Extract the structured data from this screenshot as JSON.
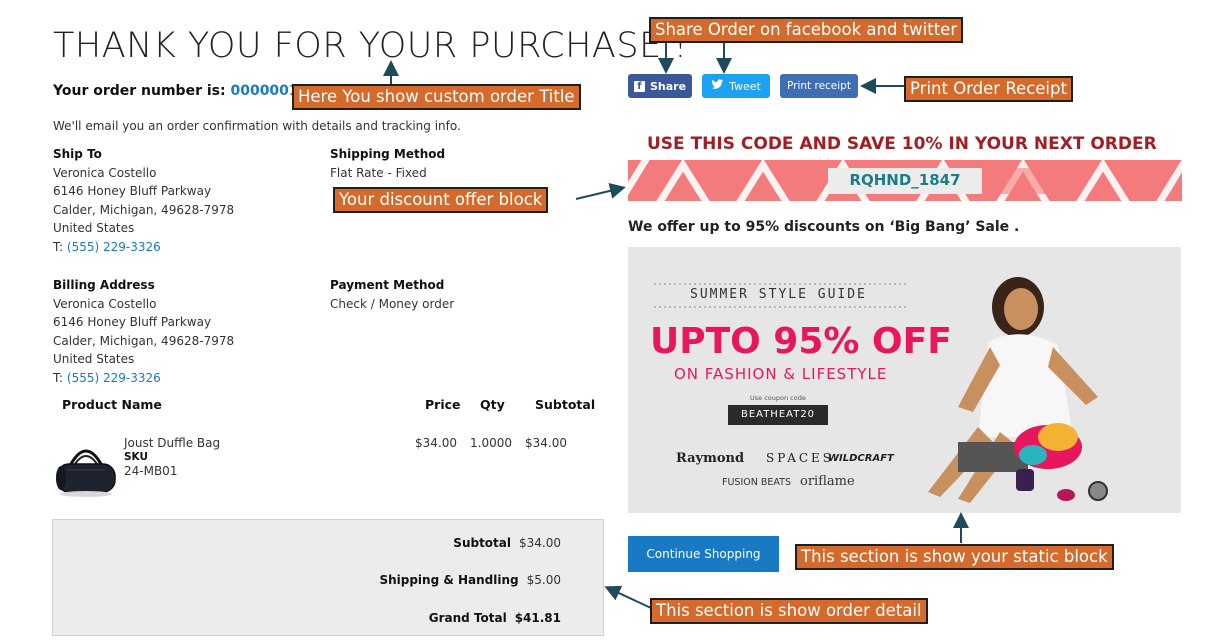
{
  "page": {
    "title": "THANK YOU FOR YOUR PURCHASE !",
    "order_label": "Your order number is:",
    "order_number": "000000119.",
    "confirmation_text": "We'll email you an order confirmation with details and tracking info."
  },
  "ship_to": {
    "heading": "Ship To",
    "name": "Veronica Costello",
    "street": "6146 Honey Bluff Parkway",
    "city": "Calder, Michigan, 49628-7978",
    "country": "United States",
    "phone_prefix": "T:",
    "phone": "(555) 229-3326"
  },
  "shipping_method": {
    "heading": "Shipping Method",
    "value": "Flat Rate - Fixed"
  },
  "billing_address": {
    "heading": "Billing Address",
    "name": "Veronica Costello",
    "street": "6146 Honey Bluff Parkway",
    "city": "Calder, Michigan, 49628-7978",
    "country": "United States",
    "phone_prefix": "T:",
    "phone": "(555) 229-3326"
  },
  "payment_method": {
    "heading": "Payment Method",
    "value": "Check / Money order"
  },
  "items_table": {
    "headers": {
      "product": "Product Name",
      "price": "Price",
      "qty": "Qty",
      "subtotal": "Subtotal"
    },
    "rows": [
      {
        "name": "Joust Duffle Bag",
        "sku_label": "SKU",
        "sku": "24-MB01",
        "price": "$34.00",
        "qty": "1.0000",
        "subtotal": "$34.00"
      }
    ]
  },
  "totals": {
    "subtotal_label": "Subtotal",
    "subtotal": "$34.00",
    "shipping_label": "Shipping & Handling",
    "shipping": "$5.00",
    "grand_label": "Grand Total",
    "grand": "$41.81"
  },
  "share": {
    "facebook": "Share",
    "twitter": "Tweet",
    "print": "Print receipt"
  },
  "discount": {
    "title": "USE THIS CODE AND SAVE 10% IN YOUR NEXT ORDER",
    "code": "RQHND_1847",
    "offer_text": "We offer up to 95% discounts on ‘Big Bang’ Sale ."
  },
  "banner": {
    "heading": "SUMMER STYLE GUIDE",
    "big": "UPTO 95% OFF",
    "sub": "ON FASHION & LIFESTYLE",
    "coupon_label": "Use coupon code",
    "coupon": "BEATHEAT20",
    "brands": [
      "Raymond",
      "SPACES",
      "WILDCRAFT",
      "FUSION BEATS",
      "oriflame"
    ]
  },
  "continue_button": "Continue Shopping",
  "callouts": {
    "share": "Share Order on facebook and twitter",
    "title": "Here You show custom order Title",
    "print": "Print Order Receipt",
    "discount": "Your discount offer block",
    "static": "This section is show your static block",
    "order_detail": "This section is show order detail"
  },
  "colors": {
    "link": "#1979c3",
    "facebook": "#3b5998",
    "twitter": "#1da1f2",
    "discount_title": "#a31e23",
    "banner_pink": "#e8175d",
    "callout": "#d46a2c"
  }
}
